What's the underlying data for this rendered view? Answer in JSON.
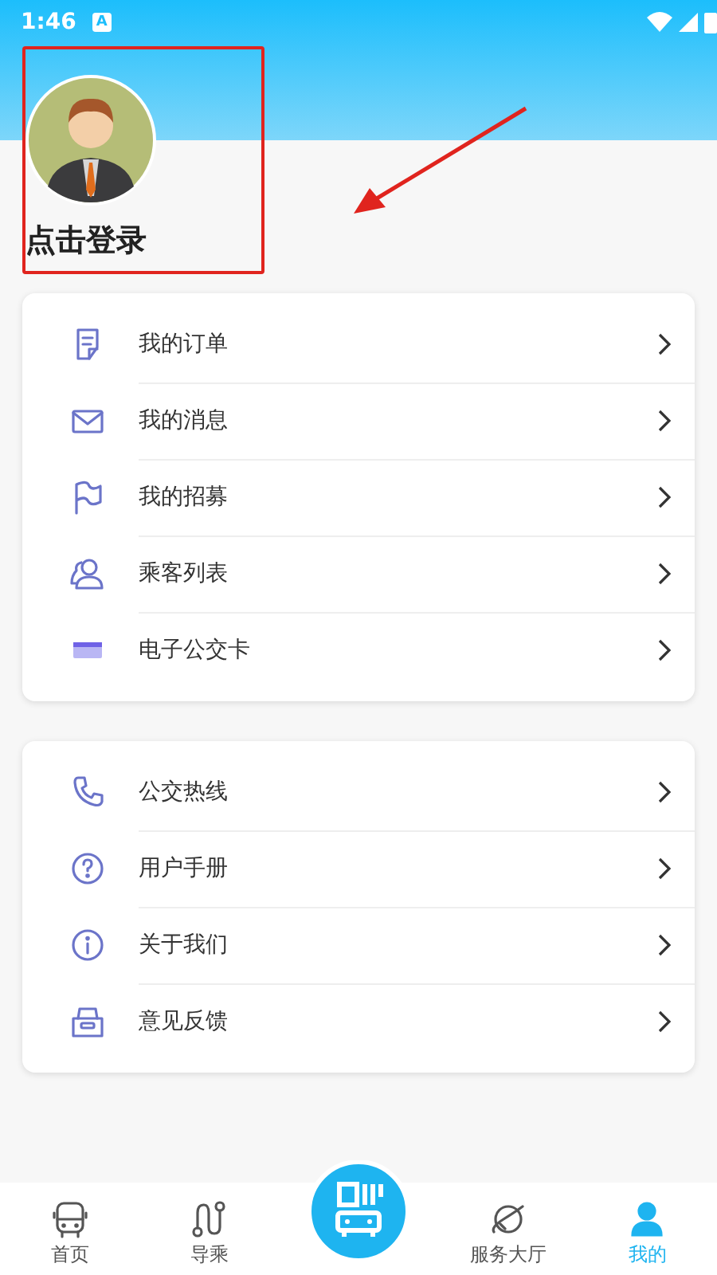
{
  "status_bar": {
    "time": "1:46",
    "notification": "A"
  },
  "profile": {
    "login_label": "点击登录"
  },
  "menu_groups": [
    {
      "items": [
        {
          "label": "我的订单",
          "kind": "order"
        },
        {
          "label": "我的消息",
          "kind": "mail"
        },
        {
          "label": "我的招募",
          "kind": "flag"
        },
        {
          "label": "乘客列表",
          "kind": "people"
        },
        {
          "label": "电子公交卡",
          "kind": "card"
        }
      ]
    },
    {
      "items": [
        {
          "label": "公交热线",
          "kind": "phone"
        },
        {
          "label": "用户手册",
          "kind": "help"
        },
        {
          "label": "关于我们",
          "kind": "info"
        },
        {
          "label": "意见反馈",
          "kind": "feedback"
        }
      ]
    }
  ],
  "tabs": [
    {
      "label": "首页",
      "kind": "bus",
      "selected": false
    },
    {
      "label": "导乘",
      "kind": "route",
      "selected": false
    },
    {
      "kind": "scan",
      "selected": false
    },
    {
      "label": "服务大厅",
      "kind": "planet",
      "selected": false
    },
    {
      "label": "我的",
      "kind": "user",
      "selected": true
    }
  ]
}
